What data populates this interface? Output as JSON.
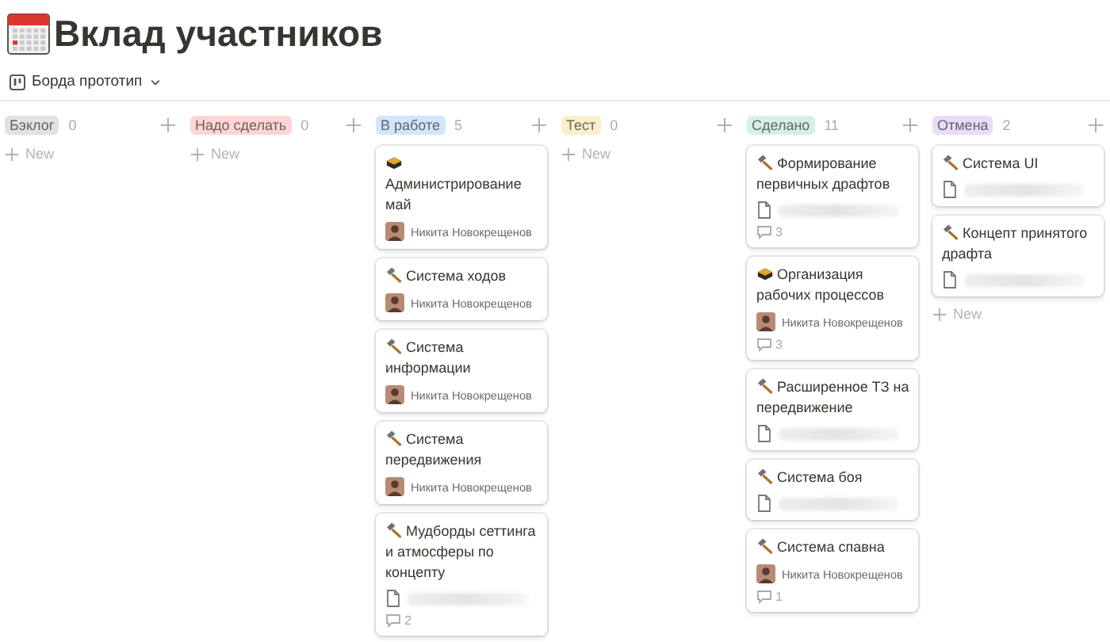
{
  "page": {
    "title": "Вклад участников"
  },
  "view": {
    "label": "Борда прототип"
  },
  "columns": [
    {
      "name": "Бэклог",
      "count": "0",
      "color": "#e3e2e0",
      "new_label": "New"
    },
    {
      "name": "Надо сделать",
      "count": "0",
      "color": "#ffd4d6",
      "new_label": "New"
    },
    {
      "name": "В работе",
      "count": "5",
      "color": "#d3e5fb",
      "cards": [
        {
          "title": "Администрирование май",
          "kind": "box",
          "person": "Никита Новокрещенов"
        },
        {
          "title": "Система ходов",
          "kind": "hammer",
          "person": "Никита Новокрещенов"
        },
        {
          "title": "Система информации",
          "kind": "hammer",
          "person": "Никита Новокрещенов"
        },
        {
          "title": "Система передвижения",
          "kind": "hammer",
          "person": "Никита Новокрещенов"
        },
        {
          "title": "Мудборды сеттинга и атмосферы по концепту",
          "kind": "hammer",
          "file": true,
          "comments": "2"
        }
      ]
    },
    {
      "name": "Тест",
      "count": "0",
      "color": "#fbeecb",
      "new_label": "New"
    },
    {
      "name": "Сделано",
      "count": "11",
      "color": "#d6efe6",
      "cards": [
        {
          "title": "Формирование первичных драфтов",
          "kind": "hammer",
          "file": true,
          "comments": "3"
        },
        {
          "title": "Организация рабочих процессов",
          "kind": "box",
          "person": "Никита Новокрещенов",
          "comments": "3"
        },
        {
          "title": "Расширенное ТЗ на передвижение",
          "kind": "hammer",
          "file": true
        },
        {
          "title": "Система боя",
          "kind": "hammer",
          "file": true
        },
        {
          "title": "Система спавна",
          "kind": "hammer",
          "person": "Никита Новокрещенов",
          "comments": "1"
        }
      ]
    },
    {
      "name": "Отмена",
      "count": "2",
      "color": "#e8dcf7",
      "new_label": "New",
      "cards": [
        {
          "title": "Система UI",
          "kind": "hammer",
          "file": true
        },
        {
          "title": "Концепт принятого драфта",
          "kind": "hammer",
          "file": true
        }
      ]
    }
  ]
}
